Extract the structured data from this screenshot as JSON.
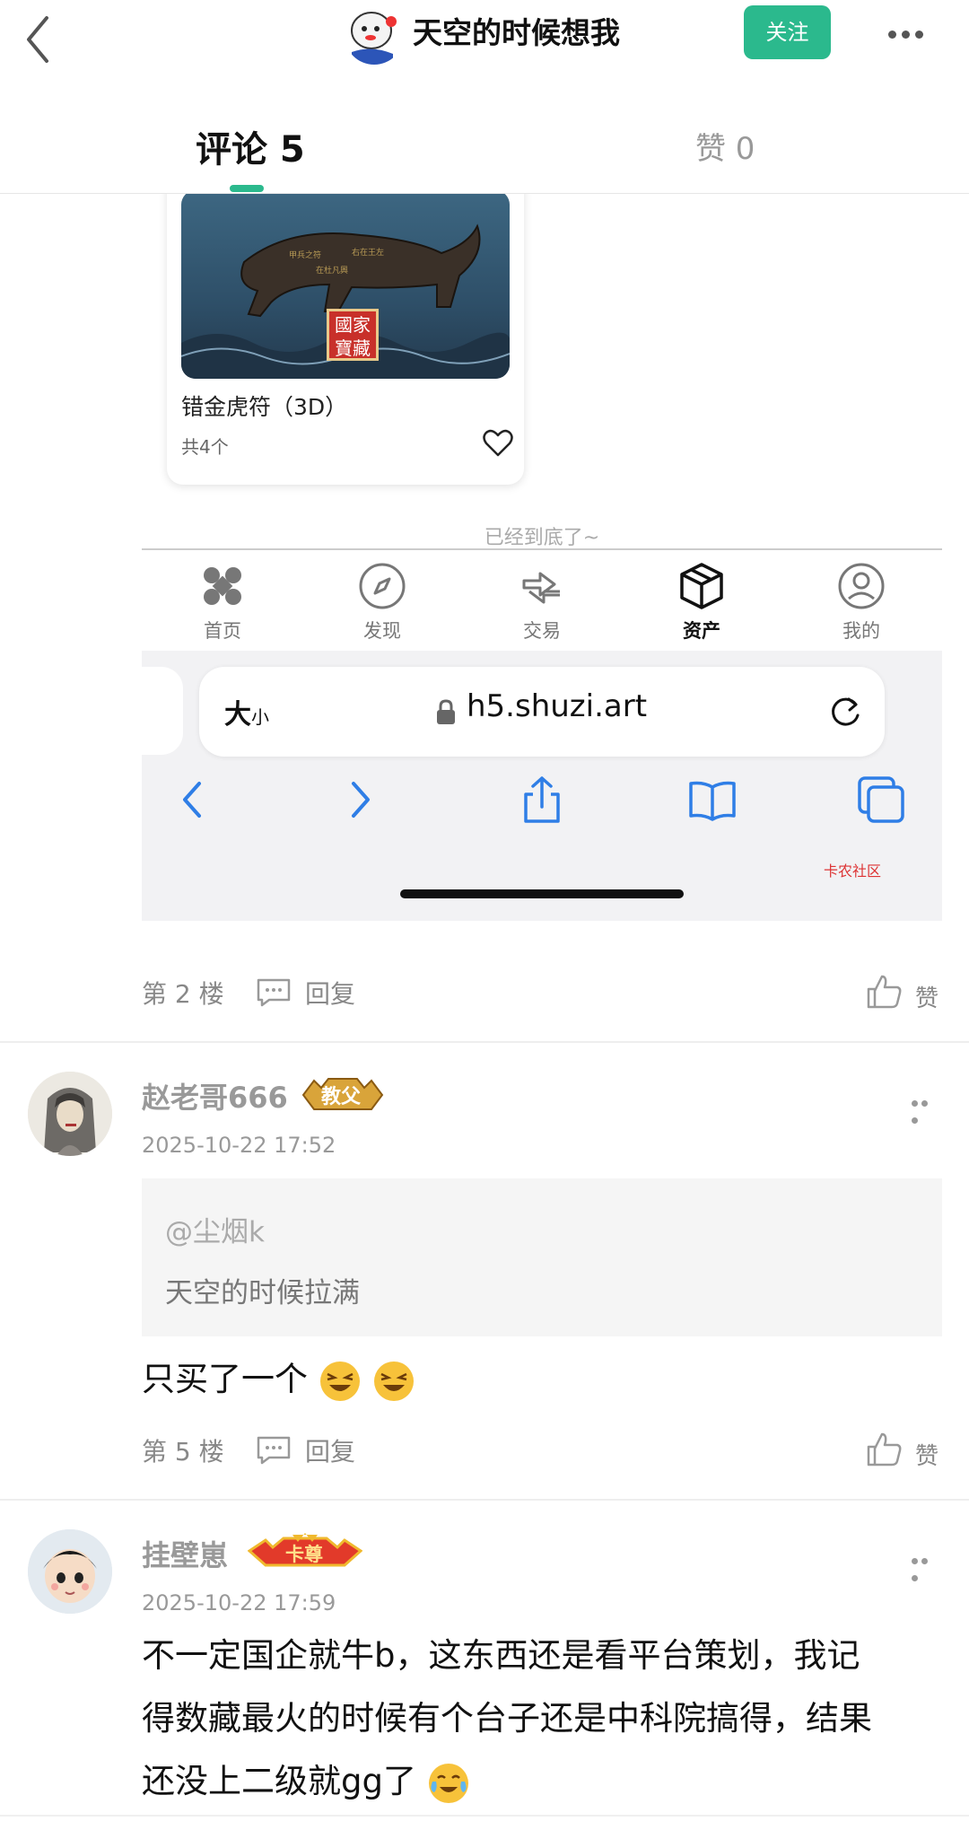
{
  "header": {
    "author_name": "天空的时候想我",
    "follow_label": "关注"
  },
  "tabs": {
    "comments_label": "评论 5",
    "likes_label": "赞 0"
  },
  "embedded_screenshot": {
    "product": {
      "badge_text": "國家寶藏",
      "title": "错金虎符（3D）",
      "count": "共4个"
    },
    "end_text": "已经到底了~",
    "nav": [
      {
        "label": "首页",
        "icon": "home-icon"
      },
      {
        "label": "发现",
        "icon": "compass-icon"
      },
      {
        "label": "交易",
        "icon": "exchange-icon"
      },
      {
        "label": "资产",
        "icon": "box-icon",
        "active": true
      },
      {
        "label": "我的",
        "icon": "profile-icon"
      }
    ],
    "browser": {
      "text_size_label_big": "大",
      "text_size_label_small": "小",
      "url": "h5.shuzi.art",
      "watermark": "卡农社区"
    }
  },
  "comment_floor2": {
    "floor": "第 2 楼",
    "reply_label": "回复",
    "like_label": "赞"
  },
  "comment_floor5": {
    "username": "赵老哥666",
    "badge": "教父",
    "time": "2025-10-22 17:52",
    "quote_user": "@尘烟k",
    "quote_text": "天空的时候拉满",
    "text": "只买了一个",
    "floor": "第 5 楼",
    "reply_label": "回复",
    "like_label": "赞"
  },
  "comment_next": {
    "username": "挂壁崽",
    "badge": "卡尊",
    "time": "2025-10-22 17:59",
    "lines": [
      "不一定国企就牛b，这东西还是看平台策划，我记",
      "得数藏最火的时候有个台子还是中科院搞得，结果",
      "还没上二级就gg了"
    ]
  },
  "colors": {
    "accent": "#2bb98d",
    "ios_blue": "#2f7ee6"
  }
}
